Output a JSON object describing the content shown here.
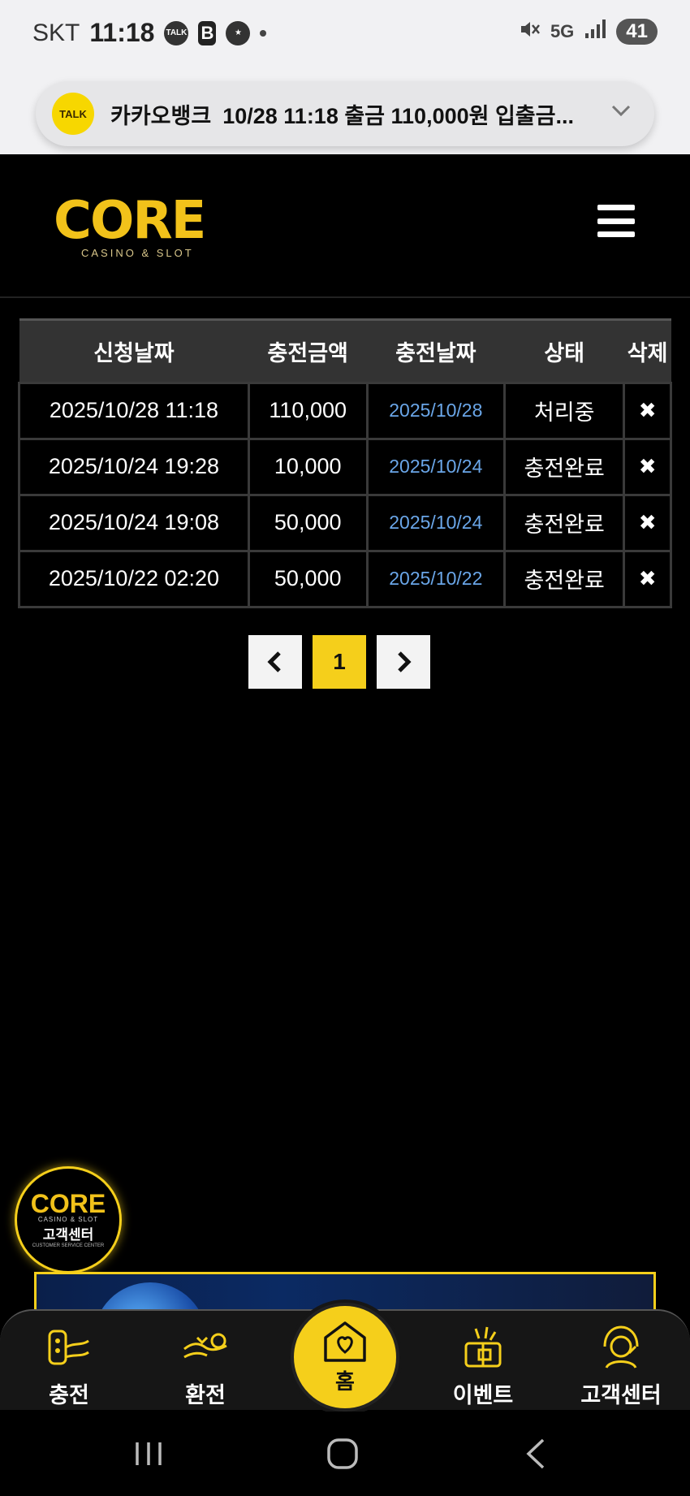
{
  "status_bar": {
    "carrier": "SKT",
    "time": "11:18",
    "icons_left": [
      "kakaotalk-icon",
      "b-icon",
      "starbucks-icon",
      "dot"
    ],
    "network": "5G",
    "battery": "41"
  },
  "notification": {
    "app": "카카오뱅크",
    "text": "10/28 11:18 출금 110,000원 입출금..."
  },
  "header": {
    "logo_text": "CORE",
    "logo_sub": "CASINO & SLOT"
  },
  "table": {
    "headers": [
      "신청날짜",
      "충전금액",
      "충전날짜",
      "상태",
      "삭제"
    ],
    "rows": [
      {
        "request_date": "2025/10/28 11:18",
        "amount": "110,000",
        "charge_date": "2025/10/28",
        "status": "처리중",
        "delete": "✖"
      },
      {
        "request_date": "2025/10/24 19:28",
        "amount": "10,000",
        "charge_date": "2025/10/24",
        "status": "충전완료",
        "delete": "✖"
      },
      {
        "request_date": "2025/10/24 19:08",
        "amount": "50,000",
        "charge_date": "2025/10/24",
        "status": "충전완료",
        "delete": "✖"
      },
      {
        "request_date": "2025/10/22 02:20",
        "amount": "50,000",
        "charge_date": "2025/10/22",
        "status": "충전완료",
        "delete": "✖"
      }
    ]
  },
  "pagination": {
    "prev": "‹",
    "current": "1",
    "next": "›"
  },
  "support_float": {
    "logo": "CORE",
    "sub": "CASINO & SLOT",
    "label": "고객센터",
    "en": "CUSTOMER SERVICE CENTER"
  },
  "bottom_nav": {
    "charge": "충전",
    "exchange": "환전",
    "home": "홈",
    "event": "이벤트",
    "support": "고객센터"
  },
  "colors": {
    "accent": "#f5cf1b",
    "link_date": "#6aa6e8",
    "background": "#000000"
  }
}
